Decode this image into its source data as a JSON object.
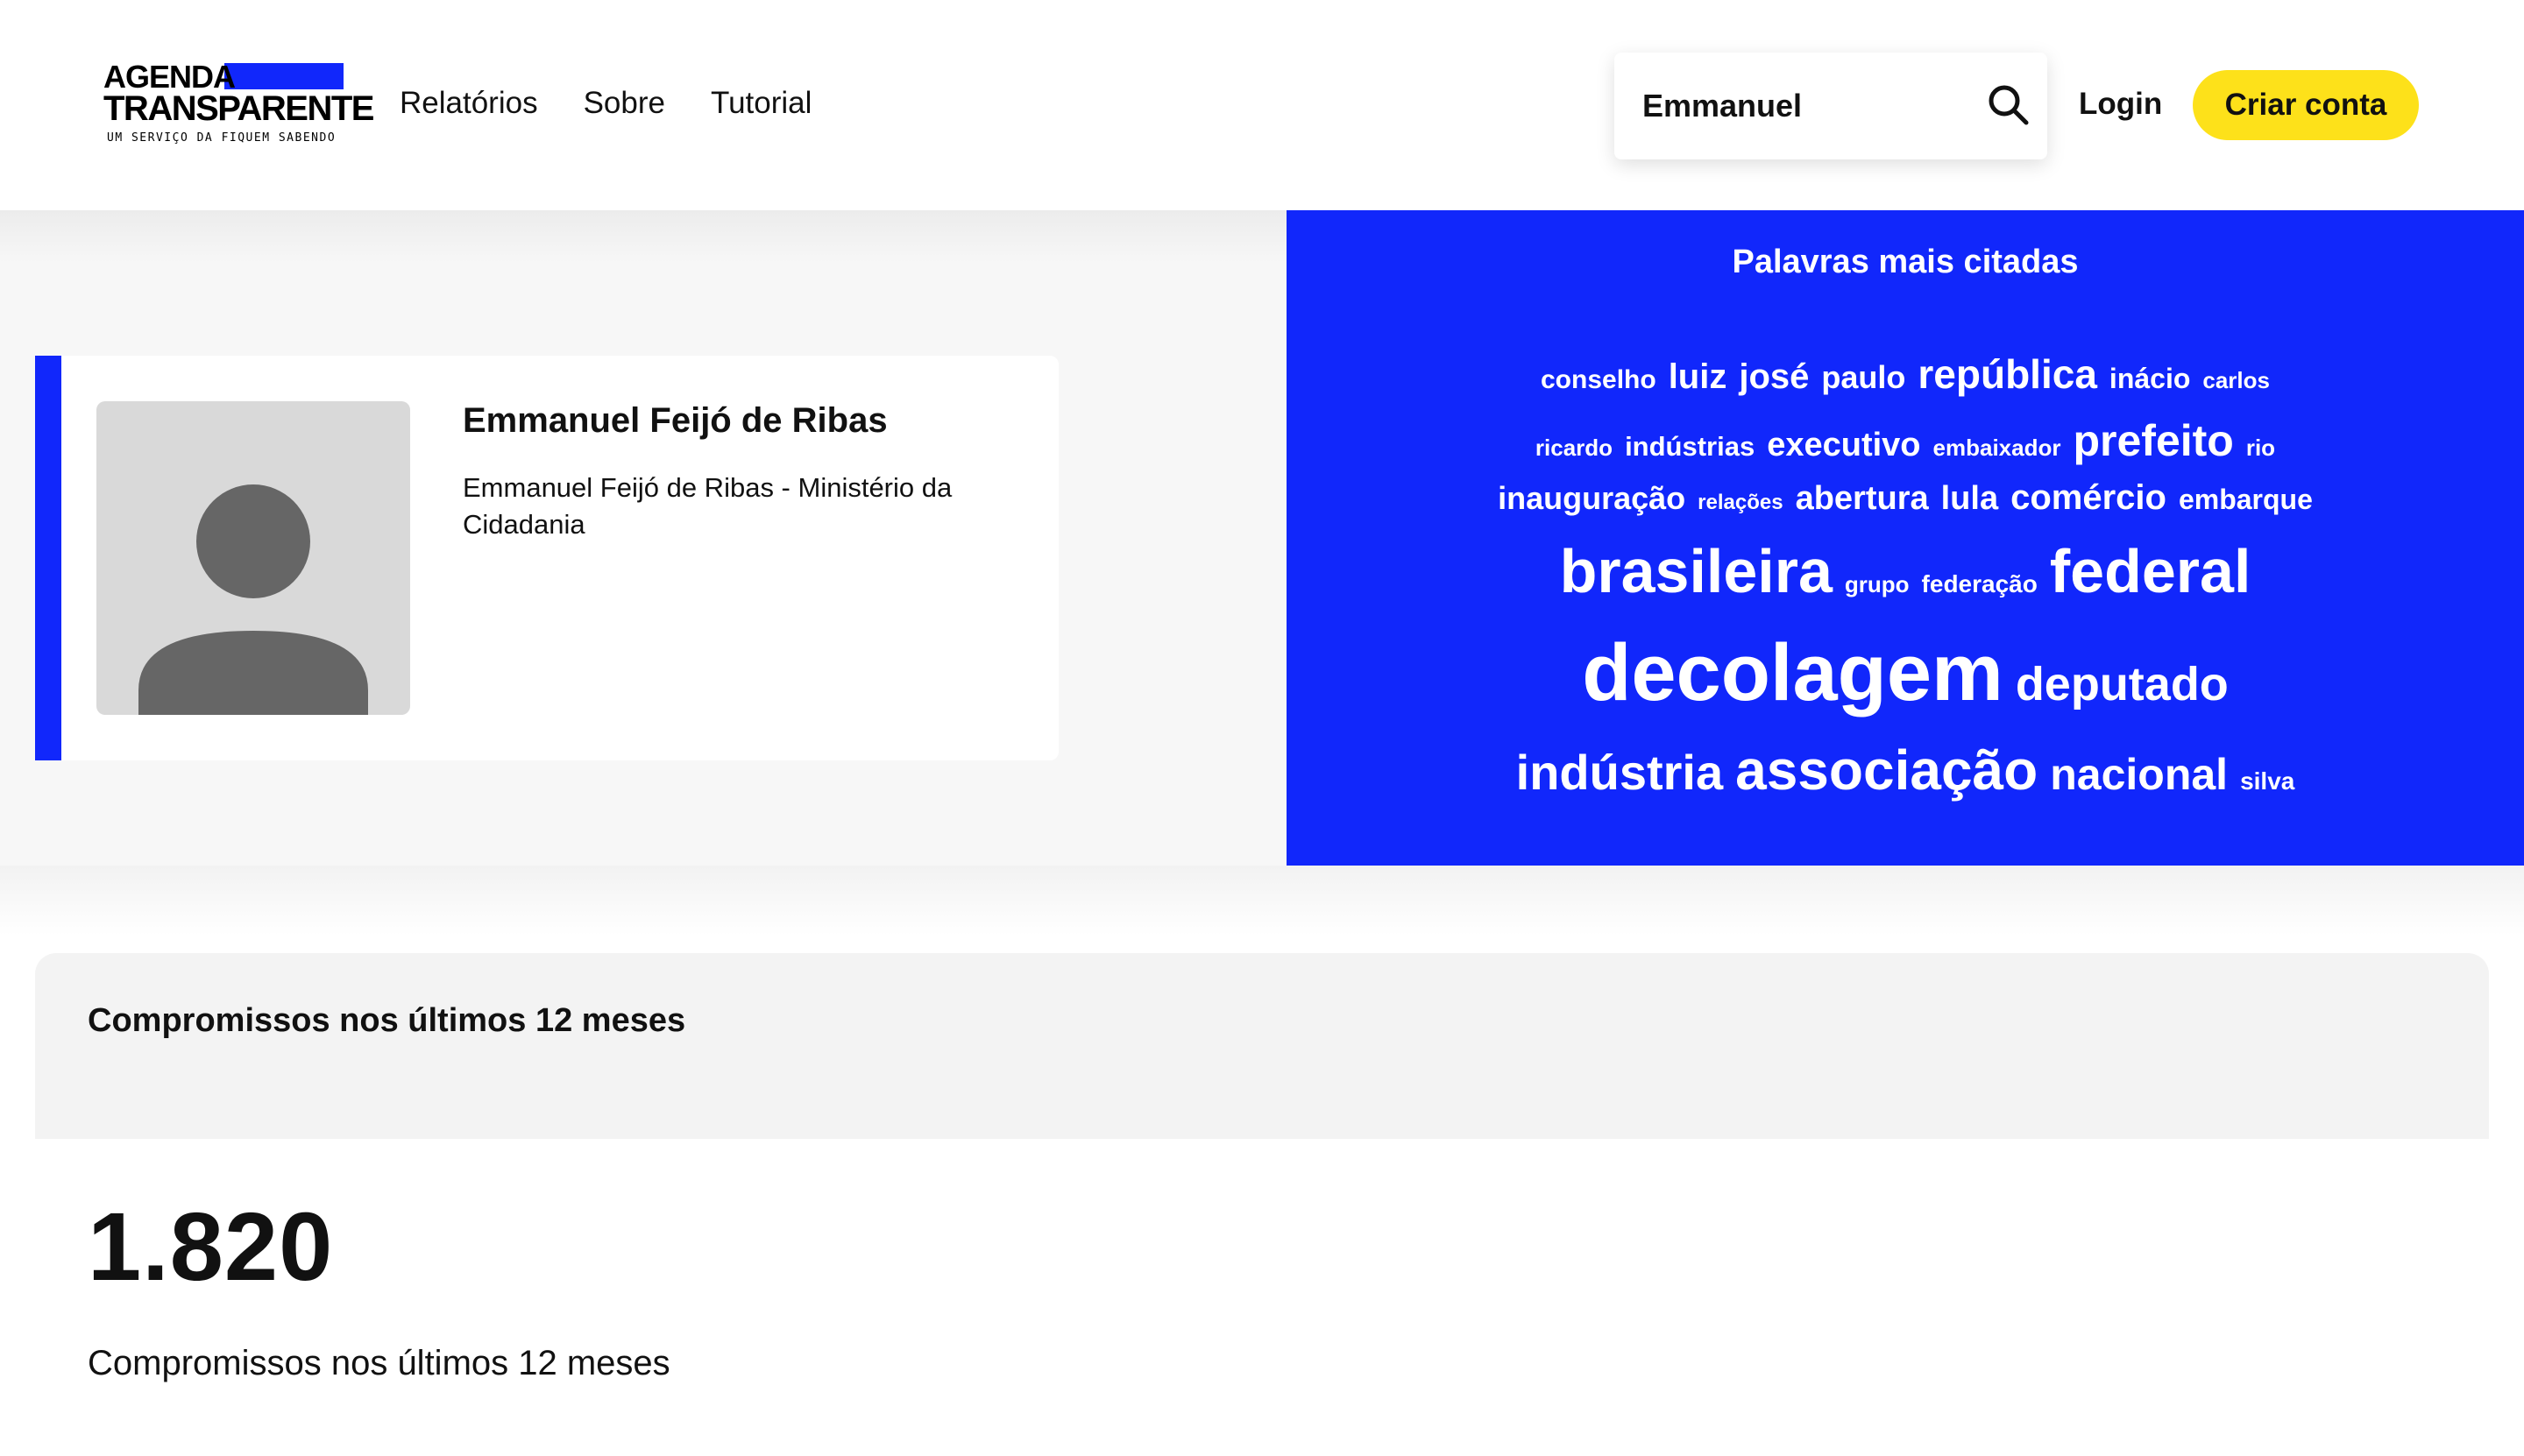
{
  "header": {
    "logo": {
      "line1": "AGENDA",
      "line2": "TRANSPARENTE",
      "tagline": "UM SERVIÇO DA FIQUEM SABENDO"
    },
    "nav": [
      {
        "label": "Relatórios"
      },
      {
        "label": "Sobre"
      },
      {
        "label": "Tutorial"
      }
    ],
    "search": {
      "value": "Emmanuel",
      "icon": "search-icon"
    },
    "login_label": "Login",
    "signup_label": "Criar conta"
  },
  "profile": {
    "name": "Emmanuel Feijó de Ribas",
    "description": "Emmanuel Feijó de Ribas - Ministério da Cidadania",
    "avatar_icon": "user-placeholder-icon"
  },
  "word_cloud": {
    "title": "Palavras mais citadas",
    "rows": [
      [
        "conselho",
        "luiz",
        "josé",
        "paulo",
        "república",
        "inácio",
        "carlos"
      ],
      [
        "ricardo",
        "indústrias",
        "executivo",
        "embaixador",
        "prefeito",
        "rio"
      ],
      [
        "inauguração",
        "relações",
        "abertura",
        "lula",
        "comércio",
        "embarque"
      ],
      [
        "brasileira",
        "grupo",
        "federação",
        "federal"
      ],
      [
        "decolagem",
        "deputado"
      ],
      [
        "indústria",
        "associação",
        "nacional",
        "silva"
      ]
    ]
  },
  "stats": {
    "title": "Compromissos nos últimos 12 meses",
    "value": "1.820",
    "caption": "Compromissos nos últimos 12 meses"
  },
  "colors": {
    "brand_blue": "#1127fb",
    "cta_yellow": "#fde11a"
  }
}
